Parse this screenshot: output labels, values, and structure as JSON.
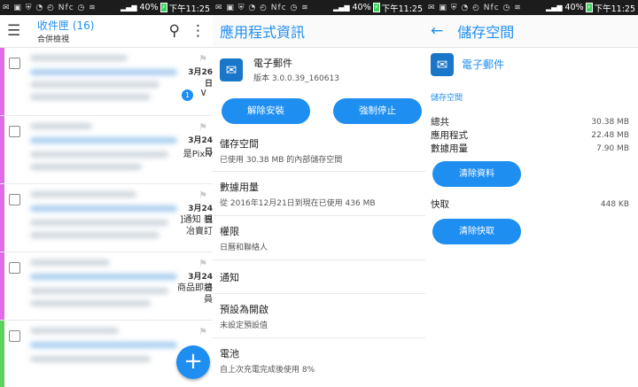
{
  "status_bar": {
    "battery": "40%",
    "time": "下午11:25",
    "icons": "✉ ▣ ⛨ ◔ ◴ Nfc ◷ ≋",
    "signal": "▂▄▆"
  },
  "inbox": {
    "title": "收件匣",
    "count": "(16)",
    "subtitle": "合併檢視",
    "mails": [
      {
        "date": "3月26日",
        "snippet": "",
        "badge": "1",
        "stripe": "#e06be6"
      },
      {
        "date": "3月24日",
        "snippet": "是Pixiv",
        "stripe": "#e06be6"
      },
      {
        "date": "3月24日",
        "snippet": "]通知 親\n冶賣訂",
        "stripe": "#e06be6"
      },
      {
        "date": "3月24日",
        "snippet": "商品即將\n員",
        "stripe": "#e06be6"
      },
      {
        "date": "",
        "snippet": "",
        "stripe": "#5cd15c"
      }
    ],
    "fab_label": "+"
  },
  "app_info": {
    "title": "應用程式資訊",
    "app_name": "電子郵件",
    "version": "版本 3.0.0.39_160613",
    "uninstall": "解除安裝",
    "force_stop": "強制停止",
    "rows": [
      {
        "title": "儲存空間",
        "sub": "已使用 30.38 MB 的內部儲存空間"
      },
      {
        "title": "數據用量",
        "sub": "從 2016年12月21日到現在已使用 436 MB"
      },
      {
        "title": "權限",
        "sub": "日曆和聯絡人"
      },
      {
        "title": "通知",
        "sub": ""
      },
      {
        "title": "預設為開啟",
        "sub": "未設定預設值"
      },
      {
        "title": "電池",
        "sub": "自上次充電完成後使用 8%"
      }
    ]
  },
  "storage": {
    "title": "儲存空間",
    "app_name": "電子郵件",
    "section": "儲存空間",
    "total_label": "總共",
    "total": "30.38 MB",
    "app_label": "應用程式",
    "app": "22.48 MB",
    "data_label": "數據用量",
    "data": "7.90 MB",
    "clear_data": "清除資料",
    "cache_label": "快取",
    "cache": "448 KB",
    "clear_cache": "清除快取"
  },
  "colors": {
    "accent": "#1e8ef0",
    "stripe_pink": "#e06be6",
    "stripe_green": "#5cd15c"
  }
}
